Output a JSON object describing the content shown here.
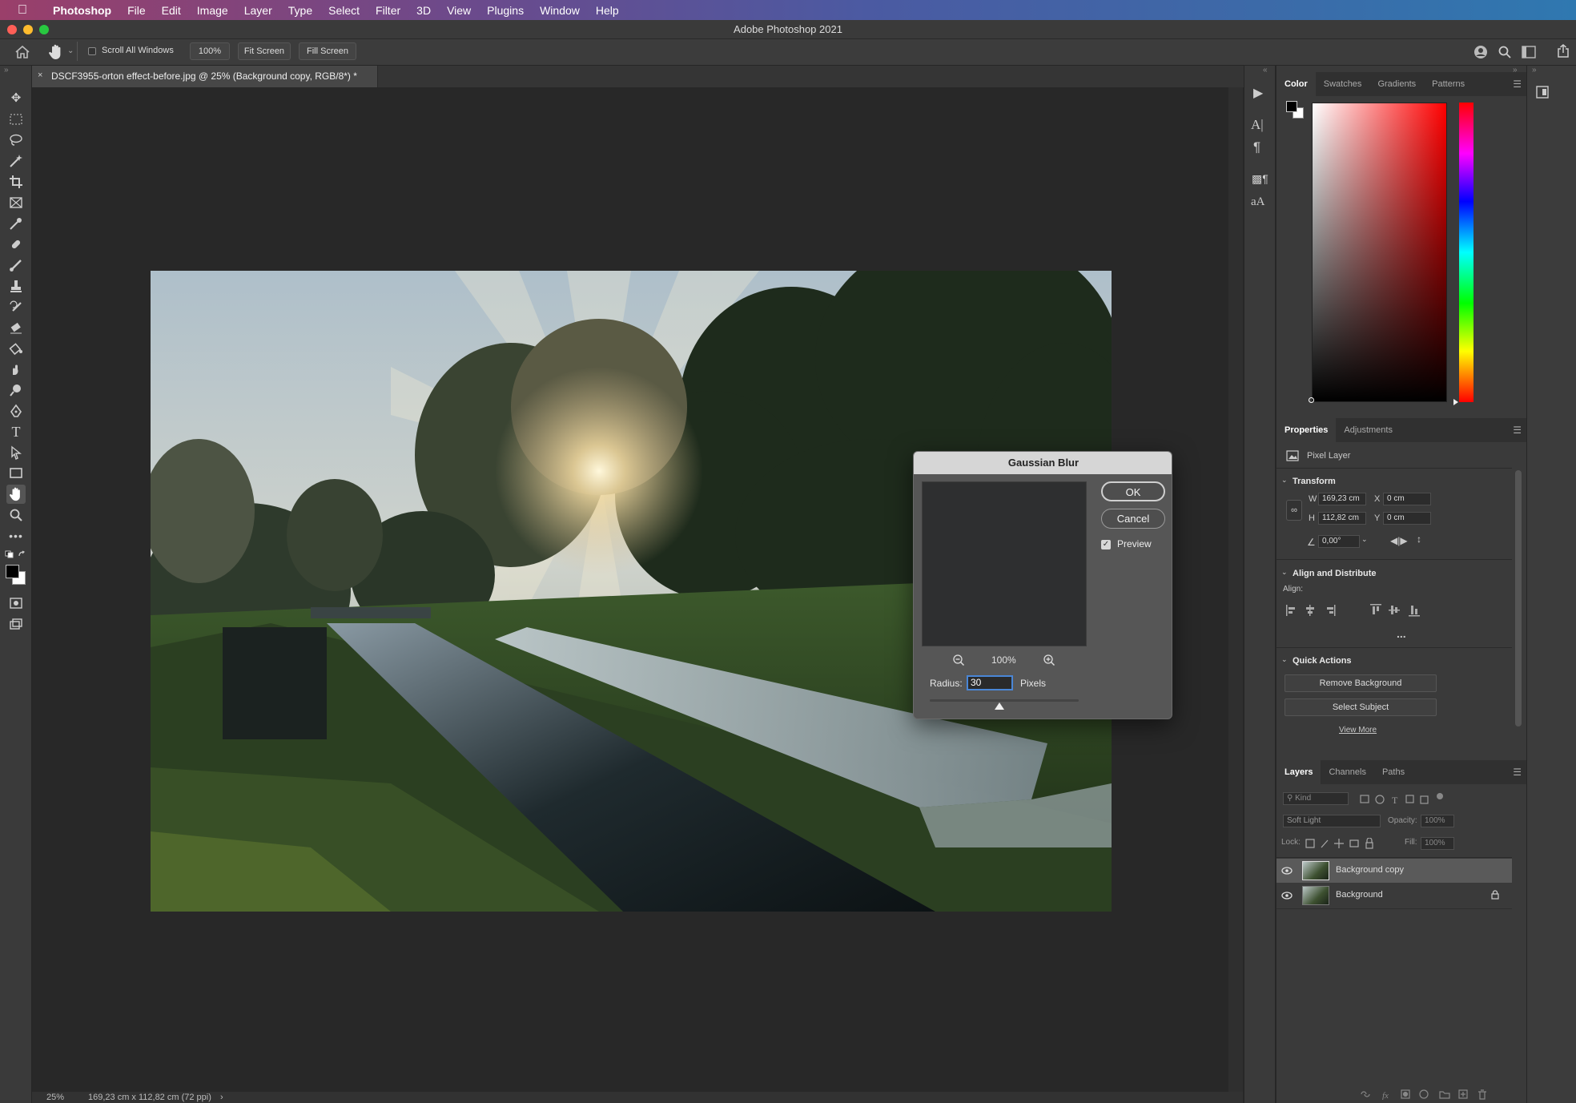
{
  "menubar": {
    "apple": "",
    "items": [
      "Photoshop",
      "File",
      "Edit",
      "Image",
      "Layer",
      "Type",
      "Select",
      "Filter",
      "3D",
      "View",
      "Plugins",
      "Window",
      "Help"
    ]
  },
  "window": {
    "title": "Adobe Photoshop 2021"
  },
  "options": {
    "scroll_all_windows": "Scroll All Windows",
    "zoom_100": "100%",
    "fit_screen": "Fit Screen",
    "fill_screen": "Fill Screen"
  },
  "document": {
    "tab_title": "DSCF3955-orton effect-before.jpg @ 25% (Background copy, RGB/8*) *"
  },
  "status": {
    "zoom": "25%",
    "doc_size": "169,23 cm x 112,82 cm (72 ppi)",
    "arrow": "›"
  },
  "color_panel": {
    "tabs": [
      "Color",
      "Swatches",
      "Gradients",
      "Patterns"
    ]
  },
  "properties_panel": {
    "tabs": [
      "Properties",
      "Adjustments"
    ],
    "layer_type": "Pixel Layer",
    "transform": {
      "heading": "Transform",
      "w_label": "W",
      "w": "169,23 cm",
      "x_label": "X",
      "x": "0 cm",
      "h_label": "H",
      "h": "112,82 cm",
      "y_label": "Y",
      "y": "0 cm",
      "angle": "0,00°"
    },
    "align": {
      "heading": "Align and Distribute",
      "label": "Align:",
      "more": "..."
    },
    "quick_actions": {
      "heading": "Quick Actions",
      "remove_background": "Remove Background",
      "select_subject": "Select Subject",
      "view_more": "View More"
    }
  },
  "layers_panel": {
    "tabs": [
      "Layers",
      "Channels",
      "Paths"
    ],
    "filter_kind": "Kind",
    "blend_mode": "Soft Light",
    "opacity_label": "Opacity:",
    "opacity": "100%",
    "lock_label": "Lock:",
    "fill_label": "Fill:",
    "fill": "100%",
    "layers": [
      {
        "name": "Background copy",
        "selected": true,
        "locked": false
      },
      {
        "name": "Background",
        "selected": false,
        "locked": true
      }
    ]
  },
  "dialog": {
    "title": "Gaussian Blur",
    "ok": "OK",
    "cancel": "Cancel",
    "preview_label": "Preview",
    "preview_checked": true,
    "zoom": "100%",
    "radius_label": "Radius:",
    "radius": "30",
    "units": "Pixels",
    "slider_fraction": 0.47
  },
  "colors": {
    "foreground": "#000000",
    "background": "#ffffff",
    "picker_hue": "#ff0000"
  }
}
